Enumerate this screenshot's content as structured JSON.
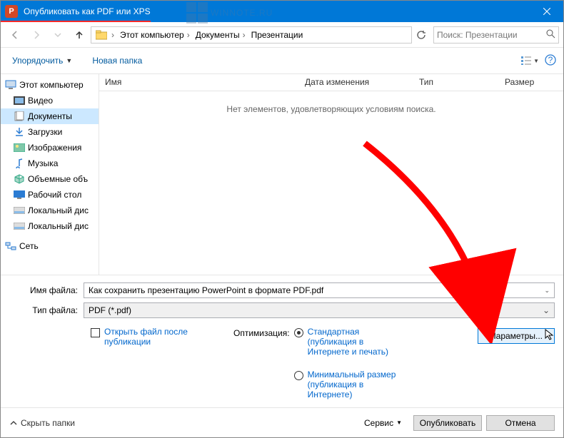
{
  "titlebar": {
    "app_letter": "P",
    "title": "Опубликовать как PDF или XPS"
  },
  "nav": {
    "crumbs": [
      "Этот компьютер",
      "Документы",
      "Презентации"
    ],
    "search_placeholder": "Поиск: Презентации"
  },
  "toolbar": {
    "organize": "Упорядочить",
    "new_folder": "Новая папка"
  },
  "sidebar": {
    "root": "Этот компьютер",
    "items": [
      {
        "icon": "video",
        "label": "Видео"
      },
      {
        "icon": "docs",
        "label": "Документы",
        "selected": true
      },
      {
        "icon": "download",
        "label": "Загрузки"
      },
      {
        "icon": "images",
        "label": "Изображения"
      },
      {
        "icon": "music",
        "label": "Музыка"
      },
      {
        "icon": "volumes",
        "label": "Объемные объ"
      },
      {
        "icon": "desktop",
        "label": "Рабочий стол"
      },
      {
        "icon": "disk",
        "label": "Локальный дис"
      },
      {
        "icon": "disk",
        "label": "Локальный дис"
      }
    ],
    "network": "Сеть"
  },
  "columns": {
    "name": "Имя",
    "date": "Дата изменения",
    "type": "Тип",
    "size": "Размер"
  },
  "filearea": {
    "empty": "Нет элементов, удовлетворяющих условиям поиска."
  },
  "fields": {
    "filename_label": "Имя файла:",
    "filename_value": "Как сохранить презентацию PowerPoint в формате PDF.pdf",
    "filetype_label": "Тип файла:",
    "filetype_value": "PDF (*.pdf)"
  },
  "options": {
    "open_after": "Открыть файл после публикации",
    "optimize_label": "Оптимизация:",
    "standard": "Стандартная (публикация в Интернете и печать)",
    "minimal": "Минимальный размер (публикация в Интернете)",
    "params": "Параметры..."
  },
  "footer": {
    "hide_folders": "Скрыть папки",
    "tools": "Сервис",
    "publish": "Опубликовать",
    "cancel": "Отмена"
  },
  "watermark": "WINNOTE.RU"
}
